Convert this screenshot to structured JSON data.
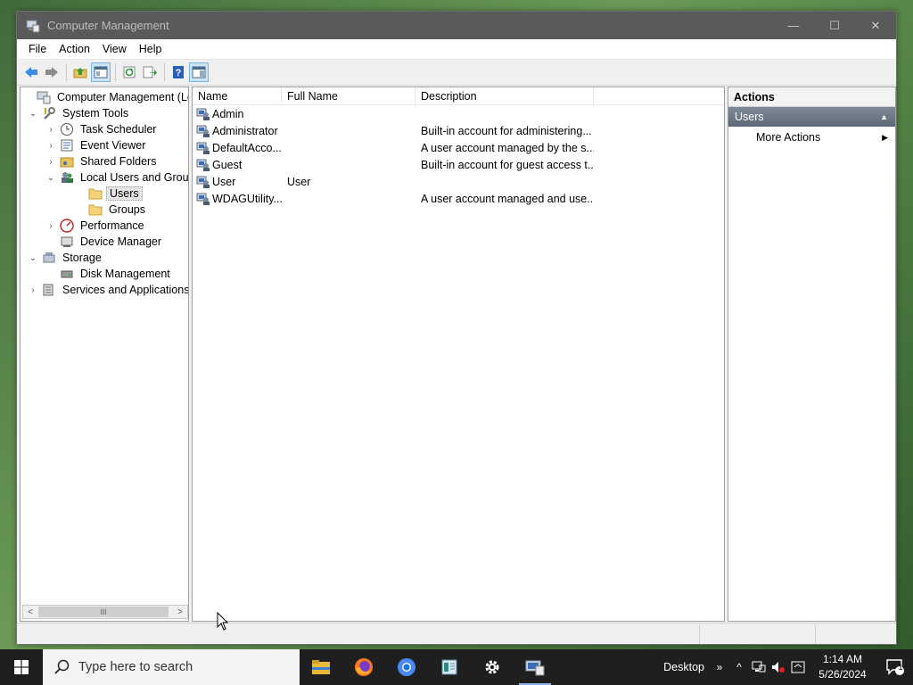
{
  "window": {
    "title": "Computer Management",
    "minimize_glyph": "—",
    "maximize_glyph": "☐",
    "close_glyph": "✕"
  },
  "menu": [
    "File",
    "Action",
    "View",
    "Help"
  ],
  "tree": [
    {
      "label": "Computer Management (Local",
      "level": 0,
      "expand": "",
      "icon": "computer-management-icon"
    },
    {
      "label": "System Tools",
      "level": 1,
      "expand": "⌄",
      "icon": "tools-icon"
    },
    {
      "label": "Task Scheduler",
      "level": 2,
      "expand": "›",
      "icon": "clock-icon"
    },
    {
      "label": "Event Viewer",
      "level": 2,
      "expand": "›",
      "icon": "event-viewer-icon"
    },
    {
      "label": "Shared Folders",
      "level": 2,
      "expand": "›",
      "icon": "shared-folder-icon"
    },
    {
      "label": "Local Users and Groups",
      "level": 2,
      "expand": "⌄",
      "icon": "users-groups-icon"
    },
    {
      "label": "Users",
      "level": 3,
      "expand": "",
      "icon": "folder-icon",
      "selected": true
    },
    {
      "label": "Groups",
      "level": 3,
      "expand": "",
      "icon": "folder-icon"
    },
    {
      "label": "Performance",
      "level": 2,
      "expand": "›",
      "icon": "performance-icon"
    },
    {
      "label": "Device Manager",
      "level": 2,
      "expand": "",
      "icon": "device-manager-icon"
    },
    {
      "label": "Storage",
      "level": 1,
      "expand": "⌄",
      "icon": "storage-icon"
    },
    {
      "label": "Disk Management",
      "level": 2,
      "expand": "",
      "icon": "disk-icon"
    },
    {
      "label": "Services and Applications",
      "level": 1,
      "expand": "›",
      "icon": "services-icon"
    }
  ],
  "list": {
    "columns": [
      "Name",
      "Full Name",
      "Description"
    ],
    "rows": [
      {
        "name": "Admin",
        "full": "",
        "desc": ""
      },
      {
        "name": "Administrator",
        "full": "",
        "desc": "Built-in account for administering..."
      },
      {
        "name": "DefaultAcco...",
        "full": "",
        "desc": "A user account managed by the s..."
      },
      {
        "name": "Guest",
        "full": "",
        "desc": "Built-in account for guest access t..."
      },
      {
        "name": "User",
        "full": "User",
        "desc": ""
      },
      {
        "name": "WDAGUtility...",
        "full": "",
        "desc": "A user account managed and use..."
      }
    ]
  },
  "actions": {
    "title": "Actions",
    "group": "Users",
    "group_caret": "▲",
    "more": "More Actions",
    "more_caret": "▶"
  },
  "scroll": {
    "left": "<",
    "right": ">",
    "grip": "III"
  },
  "taskbar": {
    "search_placeholder": "Type here to search",
    "desktop_label": "Desktop",
    "overflow": "»",
    "tray_up": "^",
    "time": "1:14 AM",
    "date": "5/26/2024",
    "notification_count": "1"
  },
  "colors": {
    "selection": "#cce4f7",
    "actions_header": "#6b7785",
    "taskbar": "#1f1f1f"
  }
}
